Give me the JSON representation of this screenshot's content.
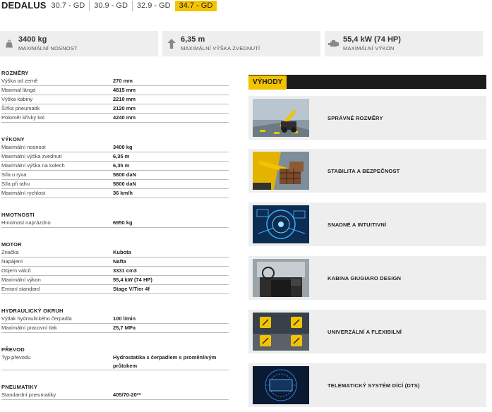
{
  "header": {
    "brand": "DEDALUS",
    "models": [
      {
        "label": "30.7 - GD",
        "active": false
      },
      {
        "label": "30.9 - GD",
        "active": false
      },
      {
        "label": "32.9 - GD",
        "active": false
      },
      {
        "label": "34.7 - GD",
        "active": true
      }
    ]
  },
  "stats": [
    {
      "icon": "weight-icon",
      "value": "3400 kg",
      "label": "MAXIMÁLNÍ NOSNOST"
    },
    {
      "icon": "lift-arrow-icon",
      "value": "6,35 m",
      "label": "MAXIMÁLNÍ VÝŠKA ZVEDNUTÍ"
    },
    {
      "icon": "engine-icon",
      "value": "55,4 kW (74 HP)",
      "label": "MAXIMÁLNÍ VÝKON"
    }
  ],
  "specs": [
    {
      "title": "ROZMĚRY",
      "rows": [
        {
          "k": "Výška od země",
          "v": "270 mm"
        },
        {
          "k": "Maximal längd",
          "v": "4815 mm"
        },
        {
          "k": "Výška kabiny",
          "v": "2210 mm"
        },
        {
          "k": "Šířka pneumatik",
          "v": "2120 mm"
        },
        {
          "k": "Poloměr křivky kol",
          "v": "4240 mm"
        }
      ]
    },
    {
      "title": "VÝKONY",
      "rows": [
        {
          "k": "Maximální nosnost",
          "v": "3400 kg"
        },
        {
          "k": "Maximální výška zvednutí",
          "v": "6,35 m"
        },
        {
          "k": "Maximální výška na kolech",
          "v": "6,35 m"
        },
        {
          "k": "Síla u ryva",
          "v": "5800 daN"
        },
        {
          "k": "Síla při tahu",
          "v": "5800 daN"
        },
        {
          "k": "Maximální rychlost",
          "v": "36 km/h"
        }
      ]
    },
    {
      "title": "HMOTNOSTI",
      "rows": [
        {
          "k": "Hmotnost naprázdno",
          "v": "6950 kg"
        }
      ]
    },
    {
      "title": "MOTOR",
      "rows": [
        {
          "k": "Značka",
          "v": "Kubota"
        },
        {
          "k": "Napájení",
          "v": "Nafta"
        },
        {
          "k": "Objem válců",
          "v": "3331 cm3"
        },
        {
          "k": "Maximální výkon",
          "v": "55,4 kW (74 HP)"
        },
        {
          "k": "Emisní standard",
          "v": "Stage V/Tier 4f"
        }
      ]
    },
    {
      "title": "HYDRAULICKÝ OKRUH",
      "rows": [
        {
          "k": "Výtlak hydraulického čerpadla",
          "v": "100 l/min"
        },
        {
          "k": "Maximální pracovní tlak",
          "v": "25,7 MPa"
        }
      ]
    },
    {
      "title": "PŘEVOD",
      "rows": [
        {
          "k": "Typ převodu",
          "v": "Hydrostatika s čerpadlem s proměnlivým průtokem",
          "tall": true
        }
      ]
    },
    {
      "title": "PNEUMATIKY",
      "rows": [
        {
          "k": "Standardní pneumatiky",
          "v": "405/70-20**"
        }
      ]
    }
  ],
  "advantages": {
    "title": "VÝHODY",
    "items": [
      {
        "label": "SPRÁVNÉ ROZMĚRY"
      },
      {
        "label": "STABILITA A BEZPEČNOST"
      },
      {
        "label": "SNADNÉ A INTUITIVNÍ"
      },
      {
        "label": "KABINA GIUGIARO DESIGN"
      },
      {
        "label": "UNIVERZÁLNÍ A FLEXIBILNÍ"
      },
      {
        "label": "TELEMATICKÝ SYSTÉM DÍCÍ (DTS)"
      }
    ]
  }
}
